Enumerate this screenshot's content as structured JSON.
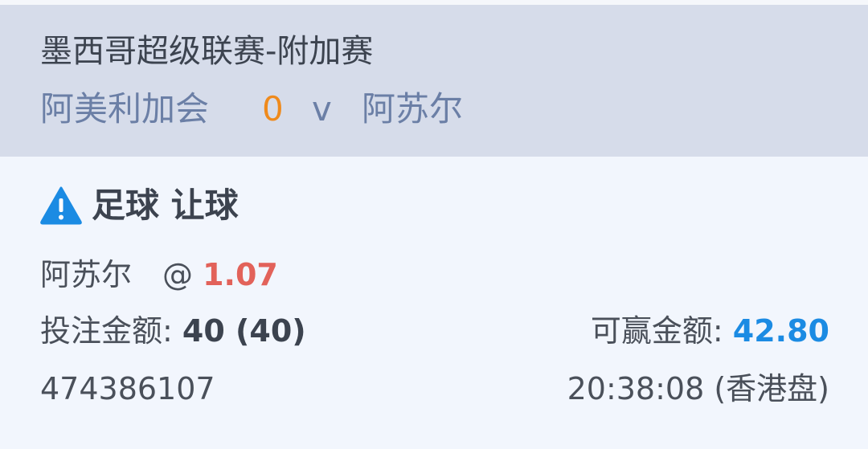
{
  "header": {
    "league": "墨西哥超级联赛-附加赛",
    "home_team": "阿美利加会",
    "score": "0",
    "vs": "v",
    "away_team": "阿苏尔"
  },
  "bet": {
    "market": "足球 让球",
    "market_icon": "warning-icon",
    "selection": "阿苏尔",
    "at": "@",
    "odds": "1.07",
    "stake_label": "投注金额:",
    "stake_value": "40 (40)",
    "win_label": "可赢金额:",
    "win_value": "42.80",
    "ticket_id": "474386107",
    "time": "20:38:08 (香港盘)"
  },
  "colors": {
    "header_bg": "#d6dcea",
    "body_bg": "#f2f6fd",
    "score": "#ef8a1c",
    "odds": "#e2625a",
    "win_amount": "#1b8be3",
    "warning_icon": "#1b8be3"
  }
}
